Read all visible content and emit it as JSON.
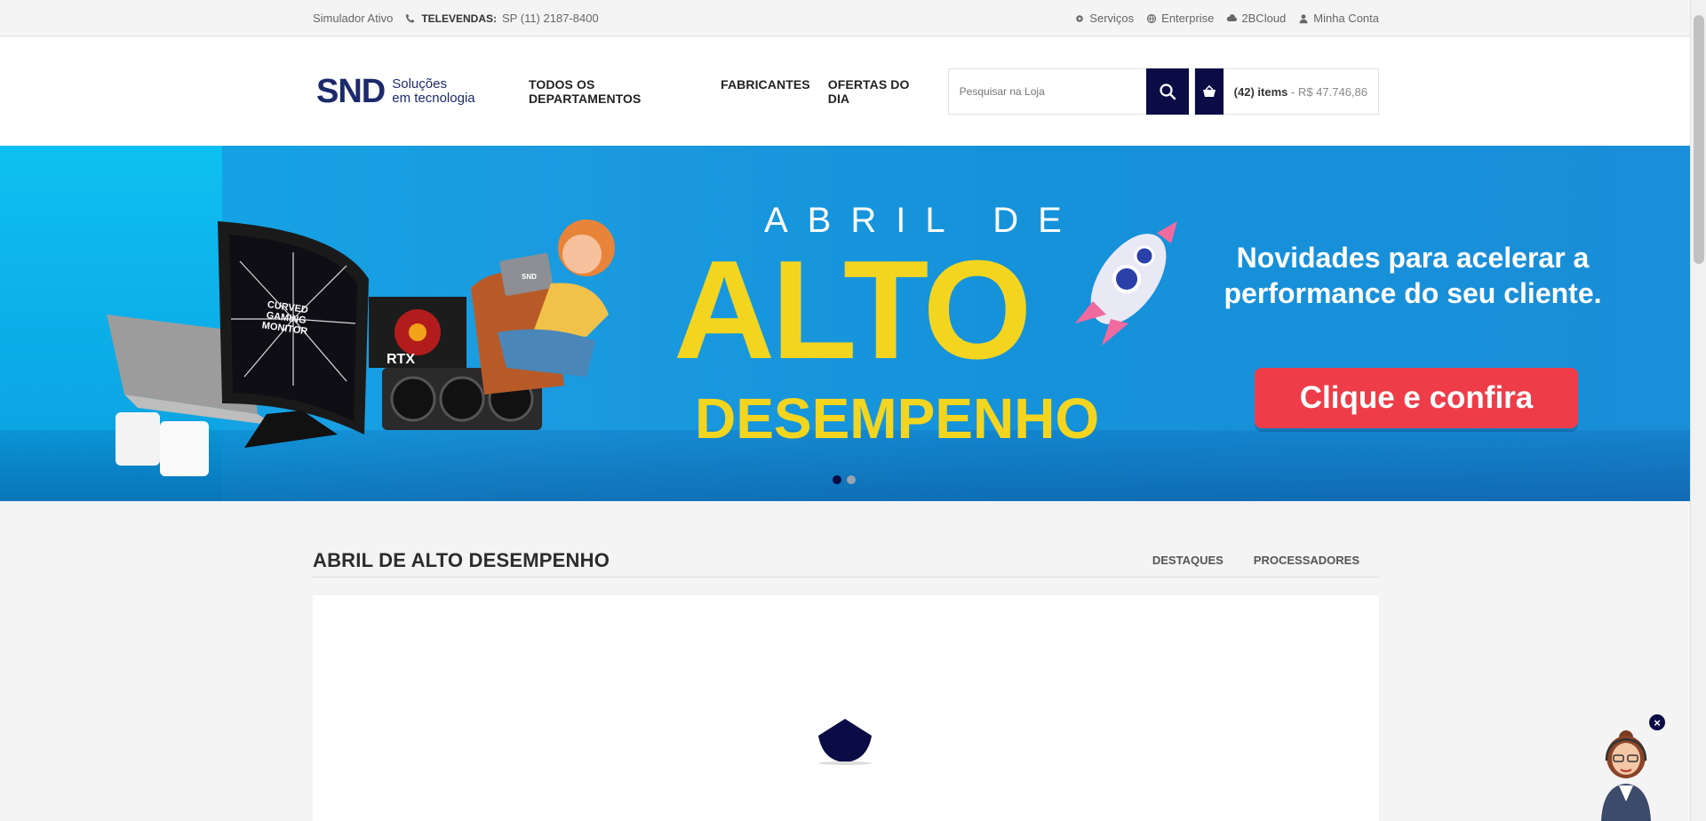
{
  "topbar": {
    "simulator": "Simulador Ativo",
    "televendas_label": "TELEVENDAS:",
    "phone": "SP (11)  2187-8400",
    "links": [
      {
        "label": "Serviços",
        "icon": "gear-icon"
      },
      {
        "label": "Enterprise",
        "icon": "globe-icon"
      },
      {
        "label": "2BCloud",
        "icon": "cloud-icon"
      },
      {
        "label": "Minha Conta",
        "icon": "user-icon"
      }
    ]
  },
  "header": {
    "logo": {
      "brand": "SND",
      "tagline_1": "Soluções",
      "tagline_2": "em tecnologia"
    },
    "nav": [
      "TODOS OS DEPARTAMENTOS",
      "FABRICANTES",
      "OFERTAS DO DIA"
    ],
    "search": {
      "placeholder": "Pesquisar na Loja"
    },
    "cart": {
      "items": "(42) items",
      "total": " - R$ 47.746,86"
    }
  },
  "banner": {
    "line1": "ABRIL DE",
    "line2": "ALTO",
    "line3": "DESEMPENHO",
    "headline": "Novidades para acelerar a performance do seu cliente.",
    "cta": "Clique e confira",
    "device_text_1": "CURVED GAMING MONITOR",
    "device_text_2": "RTX",
    "laptop_logo": "SND",
    "slides": 2,
    "active_slide": 1
  },
  "section": {
    "title": "ABRIL DE ALTO DESEMPENHO",
    "tabs": [
      "DESTAQUES",
      "PROCESSADORES"
    ]
  },
  "colors": {
    "accent": "#0b0c45",
    "cta": "#ee3d49",
    "banner_yellow": "#f3d520",
    "banner_blue": "#1592da"
  }
}
